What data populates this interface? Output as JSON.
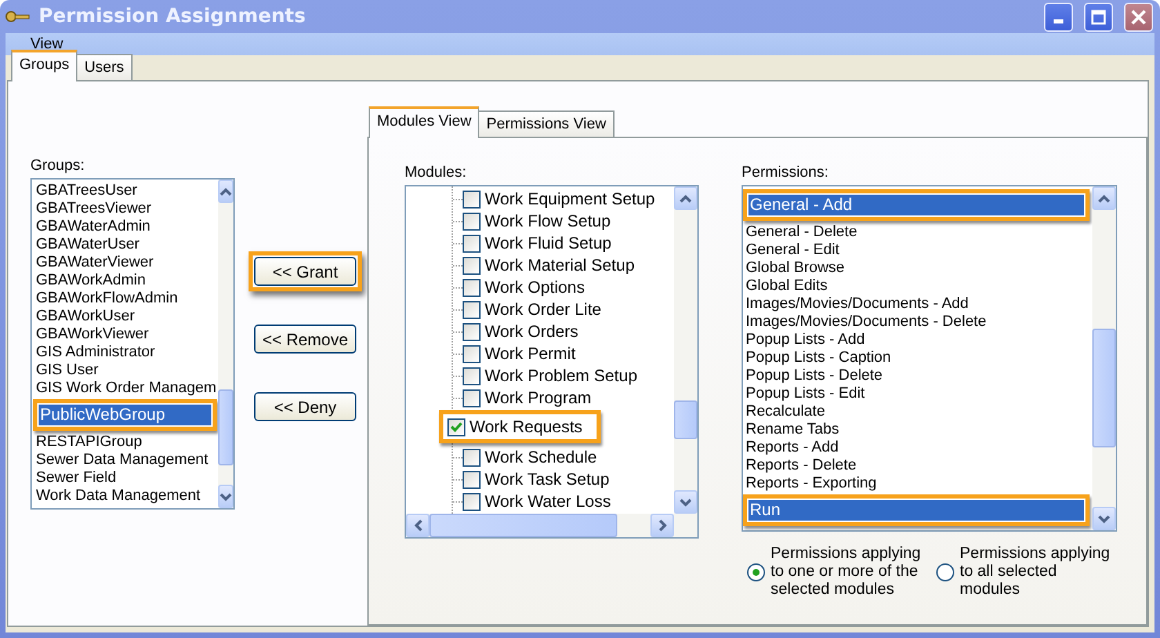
{
  "window": {
    "title": "Permission Assignments"
  },
  "menu": [
    "View"
  ],
  "tabs": [
    {
      "label": "Groups",
      "selected": true
    },
    {
      "label": "Users",
      "selected": false
    }
  ],
  "groups": {
    "label": "Groups:",
    "items": [
      {
        "label": "GBATreesUser",
        "selected": false,
        "callout": false
      },
      {
        "label": "GBATreesViewer",
        "selected": false,
        "callout": false
      },
      {
        "label": "GBAWaterAdmin",
        "selected": false,
        "callout": false
      },
      {
        "label": "GBAWaterUser",
        "selected": false,
        "callout": false
      },
      {
        "label": "GBAWaterViewer",
        "selected": false,
        "callout": false
      },
      {
        "label": "GBAWorkAdmin",
        "selected": false,
        "callout": false
      },
      {
        "label": "GBAWorkFlowAdmin",
        "selected": false,
        "callout": false
      },
      {
        "label": "GBAWorkUser",
        "selected": false,
        "callout": false
      },
      {
        "label": "GBAWorkViewer",
        "selected": false,
        "callout": false
      },
      {
        "label": "GIS Administrator",
        "selected": false,
        "callout": false
      },
      {
        "label": "GIS User",
        "selected": false,
        "callout": false
      },
      {
        "label": "GIS Work Order Managem",
        "selected": false,
        "callout": false
      },
      {
        "label": "PublicWebGroup",
        "selected": true,
        "callout": true
      },
      {
        "label": "RESTAPIGroup",
        "selected": false,
        "callout": false
      },
      {
        "label": "Sewer Data Management",
        "selected": false,
        "callout": false
      },
      {
        "label": "Sewer Field",
        "selected": false,
        "callout": false
      },
      {
        "label": "Work Data Management",
        "selected": false,
        "callout": false
      }
    ]
  },
  "buttons": [
    {
      "label": "<< Grant",
      "callout": true
    },
    {
      "label": "<< Remove",
      "callout": false
    },
    {
      "label": "<< Deny",
      "callout": false
    }
  ],
  "view_tabs": [
    {
      "label": "Modules View",
      "selected": true
    },
    {
      "label": "Permissions View",
      "selected": false
    }
  ],
  "modules": {
    "label": "Modules:",
    "items": [
      {
        "label": "Work Equipment Setup",
        "checked": false,
        "callout": false
      },
      {
        "label": "Work Flow Setup",
        "checked": false,
        "callout": false
      },
      {
        "label": "Work Fluid Setup",
        "checked": false,
        "callout": false
      },
      {
        "label": "Work Material Setup",
        "checked": false,
        "callout": false
      },
      {
        "label": "Work Options",
        "checked": false,
        "callout": false
      },
      {
        "label": "Work Order Lite",
        "checked": false,
        "callout": false
      },
      {
        "label": "Work Orders",
        "checked": false,
        "callout": false
      },
      {
        "label": "Work Permit",
        "checked": false,
        "callout": false
      },
      {
        "label": "Work Problem Setup",
        "checked": false,
        "callout": false
      },
      {
        "label": "Work Program",
        "checked": false,
        "callout": false
      },
      {
        "label": "Work Requests",
        "checked": true,
        "callout": true
      },
      {
        "label": "Work Schedule",
        "checked": false,
        "callout": false
      },
      {
        "label": "Work Task Setup",
        "checked": false,
        "callout": false
      },
      {
        "label": "Work Water Loss",
        "checked": false,
        "callout": false
      }
    ]
  },
  "permissions": {
    "label": "Permissions:",
    "items": [
      {
        "label": "General - Add",
        "selected": true,
        "callout": true
      },
      {
        "label": "General - Delete",
        "selected": false,
        "callout": false
      },
      {
        "label": "General - Edit",
        "selected": false,
        "callout": false
      },
      {
        "label": "Global Browse",
        "selected": false,
        "callout": false
      },
      {
        "label": "Global Edits",
        "selected": false,
        "callout": false
      },
      {
        "label": "Images/Movies/Documents - Add",
        "selected": false,
        "callout": false
      },
      {
        "label": "Images/Movies/Documents - Delete",
        "selected": false,
        "callout": false
      },
      {
        "label": "Popup Lists - Add",
        "selected": false,
        "callout": false
      },
      {
        "label": "Popup Lists - Caption",
        "selected": false,
        "callout": false
      },
      {
        "label": "Popup Lists - Delete",
        "selected": false,
        "callout": false
      },
      {
        "label": "Popup Lists - Edit",
        "selected": false,
        "callout": false
      },
      {
        "label": "Recalculate",
        "selected": false,
        "callout": false
      },
      {
        "label": "Rename Tabs",
        "selected": false,
        "callout": false
      },
      {
        "label": "Reports - Add",
        "selected": false,
        "callout": false
      },
      {
        "label": "Reports - Delete",
        "selected": false,
        "callout": false
      },
      {
        "label": "Reports - Exporting",
        "selected": false,
        "callout": false
      },
      {
        "label": "Run",
        "selected": true,
        "callout": true
      }
    ]
  },
  "options": [
    {
      "label": "Permissions applying to one or more of the selected modules",
      "selected": true
    },
    {
      "label": "Permissions applying to all selected modules",
      "selected": false
    }
  ]
}
